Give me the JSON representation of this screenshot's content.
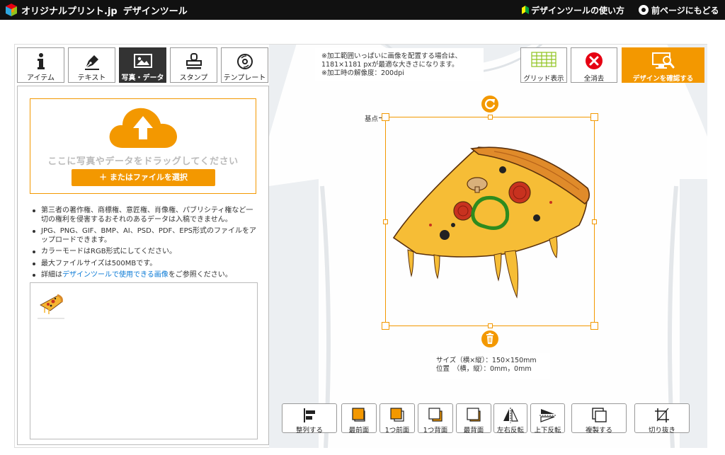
{
  "header": {
    "brand": "オリジナルプリント.jp",
    "tool_name": "デザインツール",
    "howto_link": "デザインツールの使い方",
    "back_link": "前ページにもどる"
  },
  "tabs": [
    {
      "label": "アイテム",
      "icon": "info-icon"
    },
    {
      "label": "テキスト",
      "icon": "pen-icon"
    },
    {
      "label": "写真・データ",
      "icon": "image-icon",
      "active": true
    },
    {
      "label": "スタンプ",
      "icon": "stamp-icon"
    },
    {
      "label": "テンプレート",
      "icon": "template-icon"
    }
  ],
  "upload": {
    "drop_text": "ここに写真やデータをドラッグしてください",
    "select_button": "＋ またはファイルを選択"
  },
  "notes": {
    "item1": "第三者の著作権、商標権、意匠権、肖像権、パブリシティ権など一切の権利を侵害するおそれのあるデータは入稿できません。",
    "item2": "JPG、PNG、GIF、BMP、AI、PSD、PDF、EPS形式のファイルをアップロードできます。",
    "item3": "カラーモードはRGB形式にしてください。",
    "item4": "最大ファイルサイズは500MBです。",
    "item5_prefix": "詳細は",
    "item5_link": "デザインツールで使用できる画像",
    "item5_suffix": "をご参照ください。"
  },
  "canvas": {
    "notice_line1": "※加工範囲いっぱいに画像を配置する場合は、",
    "notice_line2": "1181×1181 pxが最適な大きさになります。",
    "notice_line3": "※加工時の解像度：200dpi",
    "anchor_label": "基点",
    "size_line": "サイズ（横×縦）：150×150mm",
    "position_line": "位置　（横，縦）：0mm，0mm"
  },
  "top_buttons": {
    "grid": "グリッド表示",
    "clear": "全消去",
    "confirm": "デザインを確認する"
  },
  "bottom_buttons": {
    "align": "整列する",
    "front_most": "最前面",
    "forward": "1つ前面",
    "backward": "1つ背面",
    "back_most": "最背面",
    "flip_h": "左右反転",
    "flip_v": "上下反転",
    "duplicate": "複製する",
    "crop": "切り抜き"
  },
  "colors": {
    "accent": "#f39800",
    "header_bg": "#111111",
    "selection": "#e02020",
    "clear_red": "#e60012"
  }
}
